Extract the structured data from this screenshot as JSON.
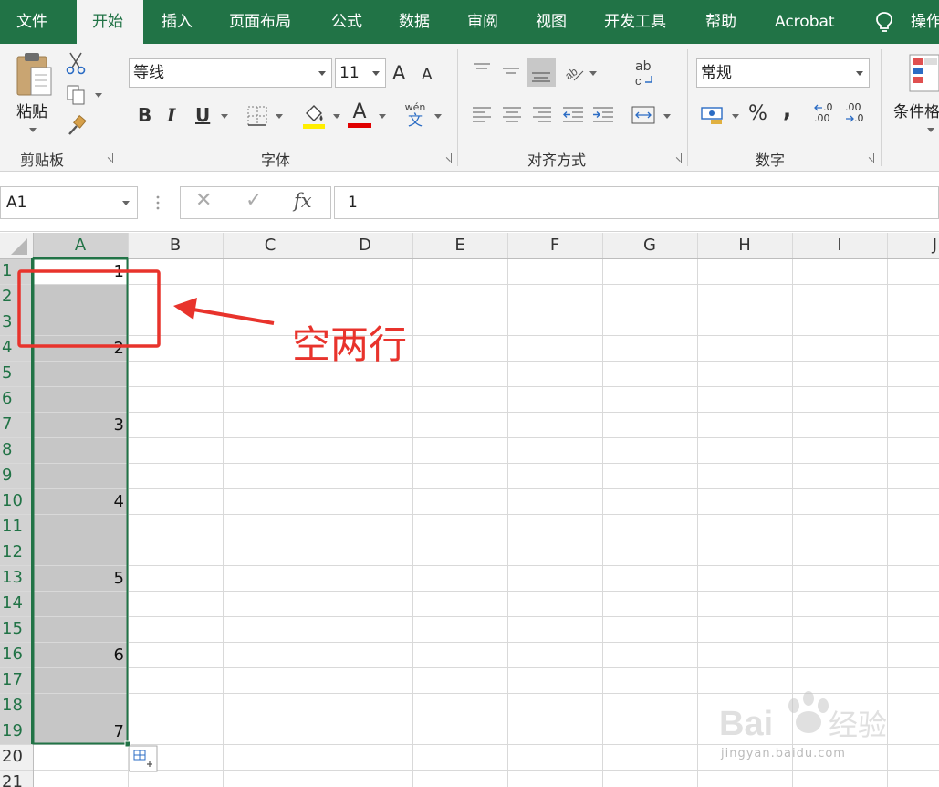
{
  "tabs": [
    {
      "label": "文件",
      "active": false
    },
    {
      "label": "开始",
      "active": true
    },
    {
      "label": "插入",
      "active": false
    },
    {
      "label": "页面布局",
      "active": false
    },
    {
      "label": "公式",
      "active": false
    },
    {
      "label": "数据",
      "active": false
    },
    {
      "label": "审阅",
      "active": false
    },
    {
      "label": "视图",
      "active": false
    },
    {
      "label": "开发工具",
      "active": false
    },
    {
      "label": "帮助",
      "active": false
    },
    {
      "label": "Acrobat",
      "active": false
    },
    {
      "label": "操作",
      "active": false
    }
  ],
  "ribbon": {
    "clipboard": {
      "paste_label": "粘贴",
      "group_label": "剪贴板"
    },
    "font": {
      "font_name": "等线",
      "font_size": "11",
      "group_label": "字体",
      "bold": "B",
      "italic": "I",
      "underline": "U",
      "phonetic": "wén",
      "phonetic_char": "文",
      "grow": "A",
      "shrink": "A",
      "font_color_glyph": "A"
    },
    "alignment": {
      "group_label": "对齐方式",
      "wrap_glyph": "ab"
    },
    "number": {
      "format": "常规",
      "group_label": "数字",
      "percent": "%",
      "comma": ",",
      "inc_decimal": ".00",
      "dec_decimal": ".0"
    },
    "styles": {
      "conditional_label": "条件格"
    }
  },
  "formula_bar": {
    "name_box": "A1",
    "cancel": "✕",
    "enter": "✓",
    "fx": "fx",
    "content": "1"
  },
  "columns": [
    "A",
    "B",
    "C",
    "D",
    "E",
    "F",
    "G",
    "H",
    "I",
    "J"
  ],
  "rows": [
    "1",
    "2",
    "3",
    "4",
    "5",
    "6",
    "7",
    "8",
    "9",
    "10",
    "11",
    "12",
    "13",
    "14",
    "15",
    "16",
    "17",
    "18",
    "19",
    "20",
    "21"
  ],
  "cells_A": [
    "1",
    "",
    "",
    "2",
    "",
    "",
    "3",
    "",
    "",
    "4",
    "",
    "",
    "5",
    "",
    "",
    "6",
    "",
    "",
    "7",
    "",
    ""
  ],
  "selection": {
    "column": "A",
    "first_row": 1,
    "last_row": 19
  },
  "annotation": {
    "text": "空两行"
  },
  "colors": {
    "ribbon_green": "#217346",
    "annotation_red": "#e8332c",
    "selection_fill": "#c6c6c6"
  },
  "watermark": {
    "brand": "Bai",
    "brand_cn": "经验",
    "url": "jingyan.baidu.com"
  }
}
